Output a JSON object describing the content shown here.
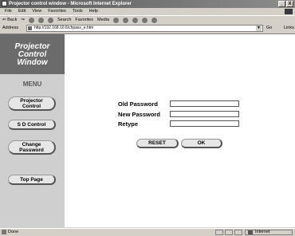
{
  "window": {
    "title": "Projector control window - Microsoft Internet Explorer",
    "minimize": "_",
    "close": "X"
  },
  "menubar": {
    "items": [
      "File",
      "Edit",
      "View",
      "Favorites",
      "Tools",
      "Help"
    ]
  },
  "toolbar": {
    "back": "⇐ Back",
    "forward": "⇒",
    "search": "Search",
    "favorites": "Favorites",
    "media": "Media"
  },
  "addressbar": {
    "label": "Address",
    "url": "http://192.168.10.6/chpass_e.htm",
    "go": "Go",
    "links": "Links"
  },
  "sidebar": {
    "logo": [
      "Projector",
      "Control",
      "Window"
    ],
    "menu_heading": "MENU",
    "buttons": {
      "projector_control": [
        "Projector",
        "Control"
      ],
      "sd_control": "S D Control",
      "change_password": [
        "Change",
        "Password"
      ],
      "top_page": "Top Page"
    }
  },
  "form": {
    "old_password_label": "Old Password",
    "new_password_label": "New Password",
    "retype_label": "Retype",
    "old_password_value": "",
    "new_password_value": "",
    "retype_value": "",
    "reset_label": "RESET",
    "ok_label": "OK"
  },
  "statusbar": {
    "status": "Done",
    "zone": "Internet"
  },
  "colors": {
    "chrome": "#d4d0c8",
    "sidebar": "#cfcfcf",
    "logo_bg": "#6b6b6b",
    "button": "#e6e6e6",
    "content": "#ffffff"
  }
}
